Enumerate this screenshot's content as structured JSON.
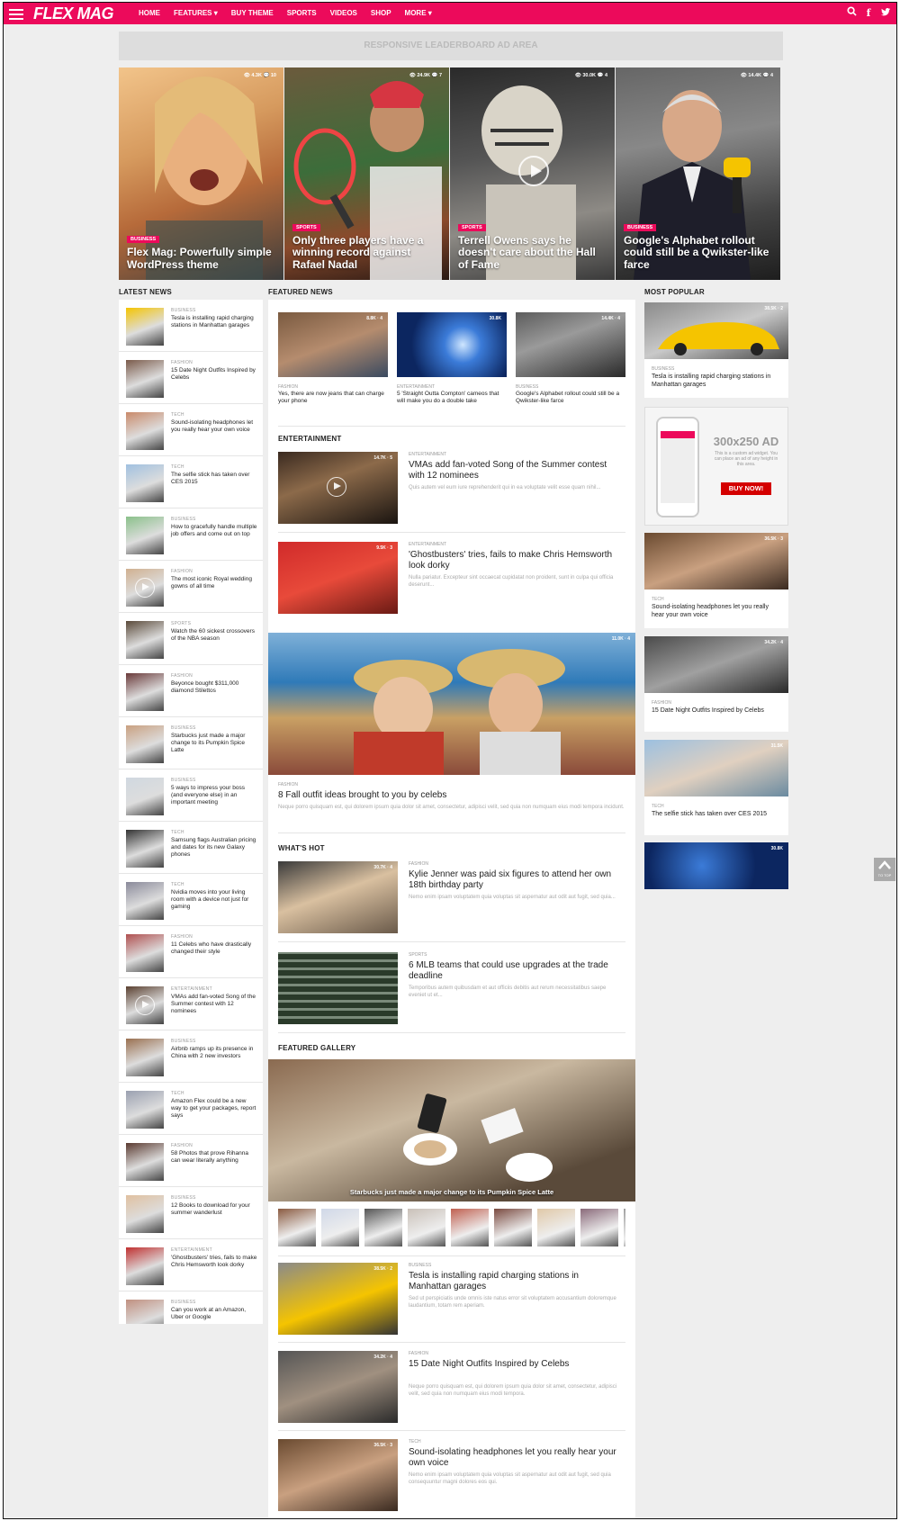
{
  "nav": {
    "logo": "FLEX MAG",
    "items": [
      "HOME",
      "FEATURES ▾",
      "BUY THEME",
      "SPORTS",
      "VIDEOS",
      "SHOP",
      "MORE ▾"
    ]
  },
  "ad": {
    "leaderboard": "RESPONSIVE LEADERBOARD AD AREA",
    "box_title": "300x250 AD",
    "box_text": "This is a custom ad widget. You can place an ad of any height in this area.",
    "box_button": "BUY NOW!"
  },
  "hero": [
    {
      "cat": "BUSINESS",
      "title": "Flex Mag: Powerfully simple WordPress theme",
      "views": "4.3K",
      "comments": "10"
    },
    {
      "cat": "SPORTS",
      "title": "Only three players have a winning record against Rafael Nadal",
      "views": "24.9K",
      "comments": "7"
    },
    {
      "cat": "SPORTS",
      "title": "Terrell Owens says he doesn't care about the Hall of Fame",
      "views": "30.0K",
      "comments": "4"
    },
    {
      "cat": "BUSINESS",
      "title": "Google's Alphabet rollout could still be a Qwikster-like farce",
      "views": "14.4K",
      "comments": "4"
    }
  ],
  "sections": {
    "latest": "LATEST NEWS",
    "featured": "FEATURED NEWS",
    "popular": "MOST POPULAR",
    "entertainment": "ENTERTAINMENT",
    "whats_hot": "WHAT'S HOT",
    "gallery": "FEATURED GALLERY"
  },
  "latest": [
    {
      "cat": "BUSINESS",
      "title": "Tesla is installing rapid charging stations in Manhattan garages"
    },
    {
      "cat": "FASHION",
      "title": "15 Date Night Outfits Inspired by Celebs"
    },
    {
      "cat": "TECH",
      "title": "Sound-isolating headphones let you really hear your own voice"
    },
    {
      "cat": "TECH",
      "title": "The selfie stick has taken over CES 2015"
    },
    {
      "cat": "BUSINESS",
      "title": "How to gracefully handle multiple job offers and come out on top"
    },
    {
      "cat": "FASHION",
      "title": "The most iconic Royal wedding gowns of all time"
    },
    {
      "cat": "SPORTS",
      "title": "Watch the 60 sickest crossovers of the NBA season"
    },
    {
      "cat": "FASHION",
      "title": "Beyonce bought $311,000 diamond Stilettos"
    },
    {
      "cat": "BUSINESS",
      "title": "Starbucks just made a major change to its Pumpkin Spice Latte"
    },
    {
      "cat": "BUSINESS",
      "title": "5 ways to impress your boss (and everyone else) in an important meeting"
    },
    {
      "cat": "TECH",
      "title": "Samsung flags Australian pricing and dates for its new Galaxy phones"
    },
    {
      "cat": "TECH",
      "title": "Nvidia moves into your living room with a device not just for gaming"
    },
    {
      "cat": "FASHION",
      "title": "11 Celebs who have drastically changed their style"
    },
    {
      "cat": "ENTERTAINMENT",
      "title": "VMAs add fan-voted Song of the Summer contest with 12 nominees"
    },
    {
      "cat": "BUSINESS",
      "title": "Airbnb ramps up its presence in China with 2 new investors"
    },
    {
      "cat": "TECH",
      "title": "Amazon Flex could be a new way to get your packages, report says"
    },
    {
      "cat": "FASHION",
      "title": "58 Photos that prove Rihanna can wear literally anything"
    },
    {
      "cat": "BUSINESS",
      "title": "12 Books to download for your summer wanderlust"
    },
    {
      "cat": "ENTERTAINMENT",
      "title": "'Ghostbusters' tries, fails to make Chris Hemsworth look dorky"
    },
    {
      "cat": "BUSINESS",
      "title": "Can you work at an Amazon, Uber or Google"
    }
  ],
  "featured": [
    {
      "cat": "FASHION",
      "title": "Yes, there are now jeans that can charge your phone",
      "views": "8.8K",
      "comments": "4"
    },
    {
      "cat": "ENTERTAINMENT",
      "title": "5 'Straight Outta Compton' cameos that will make you do a double take",
      "views": "30.8K",
      "comments": ""
    },
    {
      "cat": "BUSINESS",
      "title": "Google's Alphabet rollout could still be a Qwikster-like farce",
      "views": "14.4K",
      "comments": "4"
    }
  ],
  "entertainment": [
    {
      "cat": "ENTERTAINMENT",
      "title": "VMAs add fan-voted Song of the Summer contest with 12 nominees",
      "excerpt": "Quis autem vel eum iure reprehenderit qui in ea voluptate velit esse quam nihil...",
      "views": "14.7K",
      "comments": "5"
    },
    {
      "cat": "ENTERTAINMENT",
      "title": "'Ghostbusters' tries, fails to make Chris Hemsworth look dorky",
      "excerpt": "Nulla pariatur. Excepteur sint occaecat cupidatat non proident, sunt in culpa qui officia deserunt...",
      "views": "9.5K",
      "comments": "3"
    }
  ],
  "big_feature": {
    "cat": "FASHION",
    "title": "8 Fall outfit ideas brought to you by celebs",
    "excerpt": "Neque porro quisquam est, qui dolorem ipsum quia dolor sit amet, consectetur, adipisci velit, sed quia non numquam eius modi tempora incidunt.",
    "views": "11.0K",
    "comments": "4"
  },
  "whats_hot": [
    {
      "cat": "FASHION",
      "title": "Kylie Jenner was paid six figures to attend her own 18th birthday party",
      "excerpt": "Nemo enim ipsam voluptatem quia voluptas sit aspernatur aut odit aut fugit, sed quia...",
      "views": "30.7K",
      "comments": "4"
    },
    {
      "cat": "SPORTS",
      "title": "6 MLB teams that could use upgrades at the trade deadline",
      "excerpt": "Temporibus autem quibusdam et aut officiis debitis aut rerum necessitatibus saepe eveniet ut et...",
      "views": "",
      "comments": ""
    }
  ],
  "gallery": {
    "caption": "Starbucks just made a major change to its Pumpkin Spice Latte"
  },
  "more": [
    {
      "cat": "BUSINESS",
      "title": "Tesla is installing rapid charging stations in Manhattan garages",
      "excerpt": "Sed ut perspiciatis unde omnis iste natus error sit voluptatem accusantium doloremque laudantium, totam rem aperiam.",
      "views": "38.5K",
      "comments": "2"
    },
    {
      "cat": "FASHION",
      "title": "15 Date Night Outfits Inspired by Celebs",
      "excerpt": "Neque porro quisquam est, qui dolorem ipsum quia dolor sit amet, consectetur, adipisci velit, sed quia non numquam eius modi tempora.",
      "views": "34.2K",
      "comments": "4"
    },
    {
      "cat": "TECH",
      "title": "Sound-isolating headphones let you really hear your own voice",
      "excerpt": "Nemo enim ipsam voluptatem quia voluptas sit aspernatur aut odit aut fugit, sed quia consequuntur magni dolores eos qui.",
      "views": "36.5K",
      "comments": "3"
    }
  ],
  "popular": [
    {
      "cat": "BUSINESS",
      "title": "Tesla is installing rapid charging stations in Manhattan garages",
      "views": "38.5K",
      "comments": "2"
    },
    {
      "cat": "TECH",
      "title": "Sound-isolating headphones let you really hear your own voice",
      "views": "36.5K",
      "comments": "3"
    },
    {
      "cat": "FASHION",
      "title": "15 Date Night Outfits Inspired by Celebs",
      "views": "34.2K",
      "comments": "4"
    },
    {
      "cat": "TECH",
      "title": "The selfie stick has taken over CES 2015",
      "views": "31.5K",
      "comments": ""
    },
    {
      "cat": "",
      "title": "",
      "views": "30.8K",
      "comments": ""
    }
  ],
  "totop": "TO TOP",
  "colors": {
    "accent": "#ec0a5b"
  }
}
